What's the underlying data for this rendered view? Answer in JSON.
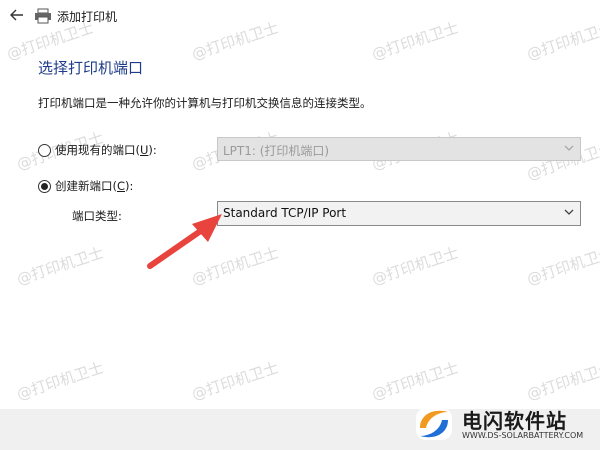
{
  "window": {
    "title": "添加打印机"
  },
  "page": {
    "heading": "选择打印机端口",
    "description": "打印机端口是一种允许你的计算机与打印机交换信息的连接类型。"
  },
  "options": {
    "use_existing": {
      "label_prefix": "使用现有的端口(",
      "hotkey": "U",
      "label_suffix": "):",
      "selected": false,
      "port_value": "LPT1: (打印机端口)"
    },
    "create_new": {
      "label_prefix": "创建新端口(",
      "hotkey": "C",
      "label_suffix": "):",
      "selected": true
    }
  },
  "port_type": {
    "label": "端口类型:",
    "value": "Standard TCP/IP Port"
  },
  "watermark": {
    "text": "@打印机卫士"
  },
  "branding": {
    "name": "电闪软件站",
    "url": "WWW.DS-SOLARBATTERY.COM"
  },
  "colors": {
    "heading": "#1f3d8a",
    "arrow": "#e8433c",
    "logo_orange": "#f29a1f",
    "logo_blue": "#1f6fd6"
  }
}
